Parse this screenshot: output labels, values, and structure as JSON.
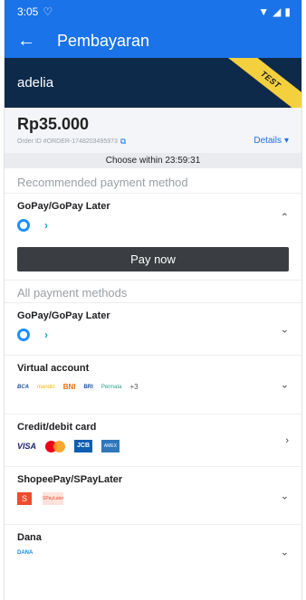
{
  "statusbar": {
    "time": "3:05"
  },
  "appbar": {
    "title": "Pembayaran"
  },
  "merchant": {
    "name": "adelia",
    "ribbon": "TEST"
  },
  "summary": {
    "amount": "Rp35.000",
    "order_id": "Order ID #ORDER-1748203495973",
    "details_label": "Details"
  },
  "timer": {
    "text": "Choose within 23:59:31"
  },
  "recommended": {
    "label": "Recommended payment method",
    "method_name": "GoPay/GoPay Later",
    "pay_button": "Pay now"
  },
  "all_methods": {
    "label": "All payment methods",
    "items": [
      {
        "name": "GoPay/GoPay Later"
      },
      {
        "name": "Virtual account",
        "logos": [
          "BCA",
          "mandiri",
          "BNI",
          "BRI",
          "Permata"
        ],
        "more": "+3"
      },
      {
        "name": "Credit/debit card",
        "logos": [
          "VISA",
          "Mastercard",
          "JCB",
          "AMEX"
        ]
      },
      {
        "name": "ShopeePay/SPayLater",
        "logos": [
          "S",
          "SPayLater"
        ]
      },
      {
        "name": "Dana",
        "logos": [
          "DANA"
        ]
      }
    ]
  },
  "colors": {
    "primary": "#1a73e8",
    "merchant_bar": "#0e2a4a",
    "ribbon": "#f4d03f",
    "button": "#3a3d41"
  }
}
